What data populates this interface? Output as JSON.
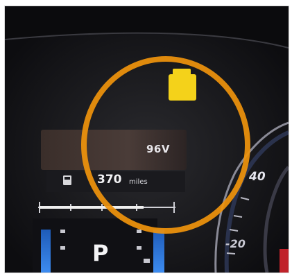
{
  "display": {
    "voltage": "96V",
    "range_value": "370",
    "range_unit": "miles",
    "gear": "P",
    "gauge_tick_40": "40",
    "gauge_tick_20": "-20"
  },
  "colors": {
    "highlight_circle": "#f0940c",
    "warning_light": "#f4d21a",
    "gauge_accent": "#2f7fe0"
  },
  "icons": {
    "warning": "yellow-warning-indicator",
    "fuel": "fuel-pump-icon"
  }
}
